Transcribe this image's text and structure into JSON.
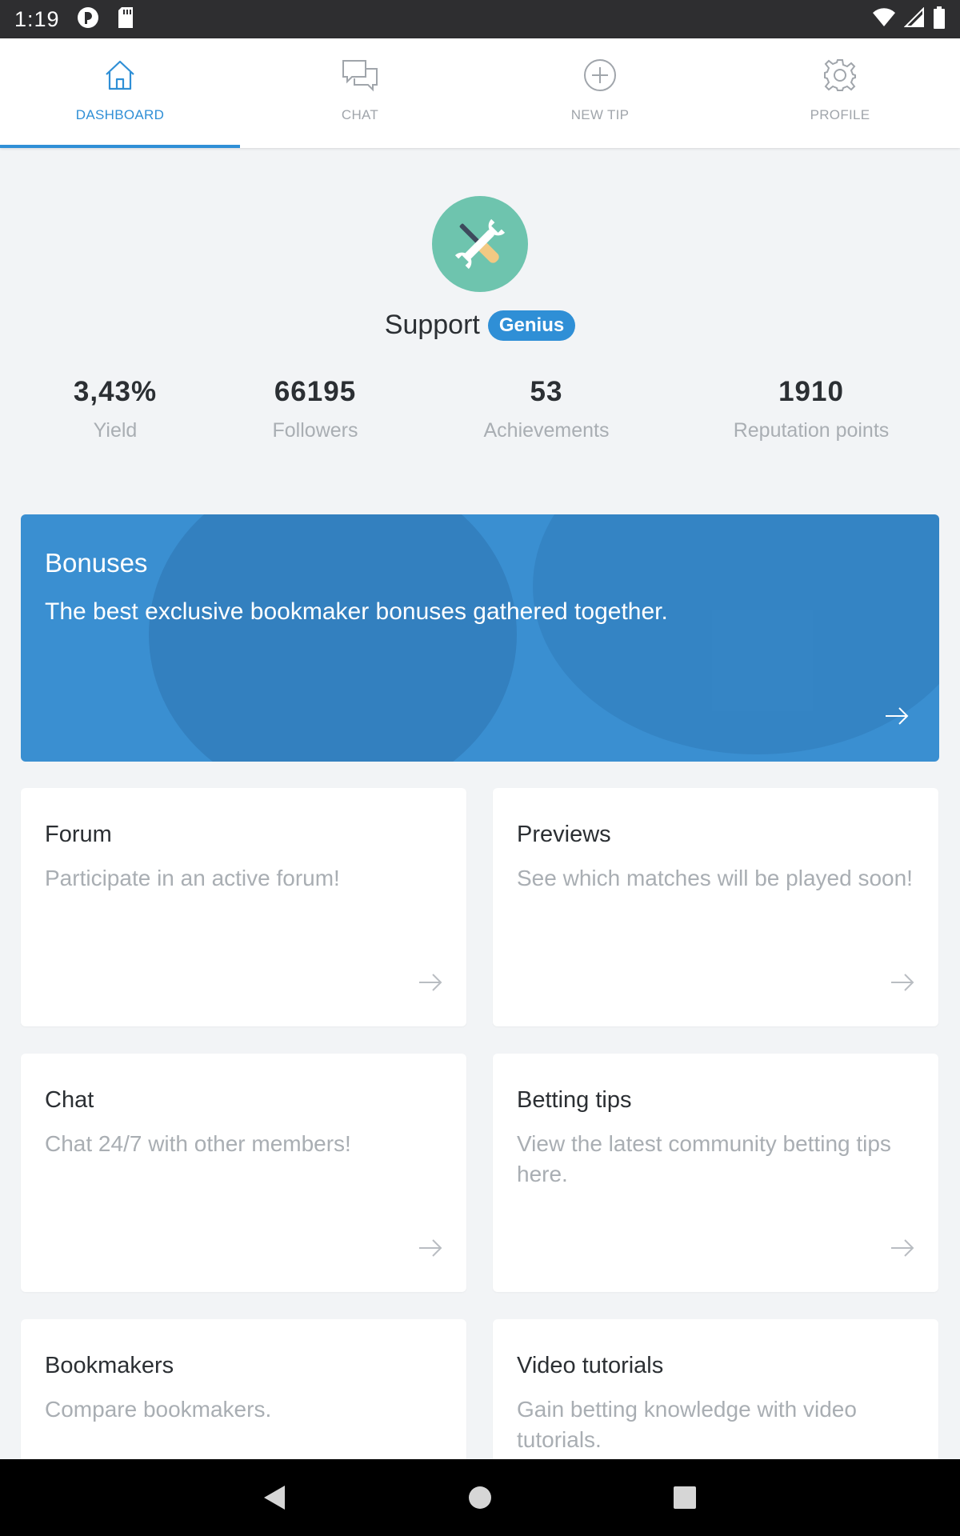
{
  "status_bar": {
    "time": "1:19"
  },
  "tabs": [
    {
      "label": "DASHBOARD",
      "icon": "home-icon",
      "active": true
    },
    {
      "label": "CHAT",
      "icon": "chat-bubbles-icon",
      "active": false
    },
    {
      "label": "NEW TIP",
      "icon": "plus-circle-icon",
      "active": false
    },
    {
      "label": "PROFILE",
      "icon": "gear-icon",
      "active": false
    }
  ],
  "profile": {
    "name": "Support",
    "badge": "Genius",
    "avatar_icon": "tools-icon"
  },
  "stats": [
    {
      "value": "3,43%",
      "label": "Yield"
    },
    {
      "value": "66195",
      "label": "Followers"
    },
    {
      "value": "53",
      "label": "Achievements"
    },
    {
      "value": "1910",
      "label": "Reputation points"
    }
  ],
  "banner": {
    "title": "Bonuses",
    "description": "The best exclusive bookmaker bonuses gathered together."
  },
  "cards": [
    {
      "title": "Forum",
      "description": "Participate in an active forum!"
    },
    {
      "title": "Previews",
      "description": "See which matches will be played soon!"
    },
    {
      "title": "Chat",
      "description": "Chat 24/7 with other members!"
    },
    {
      "title": "Betting tips",
      "description": "View the latest community betting tips here."
    },
    {
      "title": "Bookmakers",
      "description": "Compare bookmakers."
    },
    {
      "title": "Video tutorials",
      "description": "Gain betting knowledge with video tutorials."
    }
  ],
  "colors": {
    "accent": "#2f8fd6",
    "background": "#f2f4f6",
    "banner": "#3a8fd1",
    "avatar": "#6ec4ae"
  }
}
